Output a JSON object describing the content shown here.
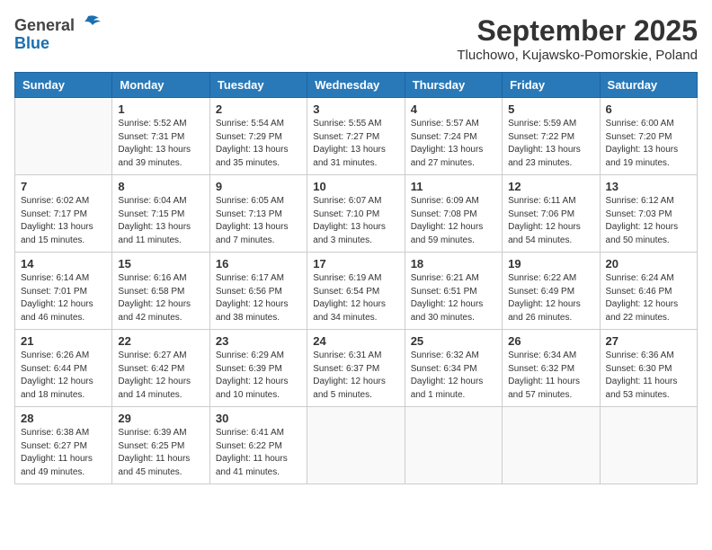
{
  "header": {
    "logo_general": "General",
    "logo_blue": "Blue",
    "month": "September 2025",
    "location": "Tluchowo, Kujawsko-Pomorskie, Poland"
  },
  "weekdays": [
    "Sunday",
    "Monday",
    "Tuesday",
    "Wednesday",
    "Thursday",
    "Friday",
    "Saturday"
  ],
  "weeks": [
    [
      {
        "day": "",
        "info": ""
      },
      {
        "day": "1",
        "info": "Sunrise: 5:52 AM\nSunset: 7:31 PM\nDaylight: 13 hours\nand 39 minutes."
      },
      {
        "day": "2",
        "info": "Sunrise: 5:54 AM\nSunset: 7:29 PM\nDaylight: 13 hours\nand 35 minutes."
      },
      {
        "day": "3",
        "info": "Sunrise: 5:55 AM\nSunset: 7:27 PM\nDaylight: 13 hours\nand 31 minutes."
      },
      {
        "day": "4",
        "info": "Sunrise: 5:57 AM\nSunset: 7:24 PM\nDaylight: 13 hours\nand 27 minutes."
      },
      {
        "day": "5",
        "info": "Sunrise: 5:59 AM\nSunset: 7:22 PM\nDaylight: 13 hours\nand 23 minutes."
      },
      {
        "day": "6",
        "info": "Sunrise: 6:00 AM\nSunset: 7:20 PM\nDaylight: 13 hours\nand 19 minutes."
      }
    ],
    [
      {
        "day": "7",
        "info": "Sunrise: 6:02 AM\nSunset: 7:17 PM\nDaylight: 13 hours\nand 15 minutes."
      },
      {
        "day": "8",
        "info": "Sunrise: 6:04 AM\nSunset: 7:15 PM\nDaylight: 13 hours\nand 11 minutes."
      },
      {
        "day": "9",
        "info": "Sunrise: 6:05 AM\nSunset: 7:13 PM\nDaylight: 13 hours\nand 7 minutes."
      },
      {
        "day": "10",
        "info": "Sunrise: 6:07 AM\nSunset: 7:10 PM\nDaylight: 13 hours\nand 3 minutes."
      },
      {
        "day": "11",
        "info": "Sunrise: 6:09 AM\nSunset: 7:08 PM\nDaylight: 12 hours\nand 59 minutes."
      },
      {
        "day": "12",
        "info": "Sunrise: 6:11 AM\nSunset: 7:06 PM\nDaylight: 12 hours\nand 54 minutes."
      },
      {
        "day": "13",
        "info": "Sunrise: 6:12 AM\nSunset: 7:03 PM\nDaylight: 12 hours\nand 50 minutes."
      }
    ],
    [
      {
        "day": "14",
        "info": "Sunrise: 6:14 AM\nSunset: 7:01 PM\nDaylight: 12 hours\nand 46 minutes."
      },
      {
        "day": "15",
        "info": "Sunrise: 6:16 AM\nSunset: 6:58 PM\nDaylight: 12 hours\nand 42 minutes."
      },
      {
        "day": "16",
        "info": "Sunrise: 6:17 AM\nSunset: 6:56 PM\nDaylight: 12 hours\nand 38 minutes."
      },
      {
        "day": "17",
        "info": "Sunrise: 6:19 AM\nSunset: 6:54 PM\nDaylight: 12 hours\nand 34 minutes."
      },
      {
        "day": "18",
        "info": "Sunrise: 6:21 AM\nSunset: 6:51 PM\nDaylight: 12 hours\nand 30 minutes."
      },
      {
        "day": "19",
        "info": "Sunrise: 6:22 AM\nSunset: 6:49 PM\nDaylight: 12 hours\nand 26 minutes."
      },
      {
        "day": "20",
        "info": "Sunrise: 6:24 AM\nSunset: 6:46 PM\nDaylight: 12 hours\nand 22 minutes."
      }
    ],
    [
      {
        "day": "21",
        "info": "Sunrise: 6:26 AM\nSunset: 6:44 PM\nDaylight: 12 hours\nand 18 minutes."
      },
      {
        "day": "22",
        "info": "Sunrise: 6:27 AM\nSunset: 6:42 PM\nDaylight: 12 hours\nand 14 minutes."
      },
      {
        "day": "23",
        "info": "Sunrise: 6:29 AM\nSunset: 6:39 PM\nDaylight: 12 hours\nand 10 minutes."
      },
      {
        "day": "24",
        "info": "Sunrise: 6:31 AM\nSunset: 6:37 PM\nDaylight: 12 hours\nand 5 minutes."
      },
      {
        "day": "25",
        "info": "Sunrise: 6:32 AM\nSunset: 6:34 PM\nDaylight: 12 hours\nand 1 minute."
      },
      {
        "day": "26",
        "info": "Sunrise: 6:34 AM\nSunset: 6:32 PM\nDaylight: 11 hours\nand 57 minutes."
      },
      {
        "day": "27",
        "info": "Sunrise: 6:36 AM\nSunset: 6:30 PM\nDaylight: 11 hours\nand 53 minutes."
      }
    ],
    [
      {
        "day": "28",
        "info": "Sunrise: 6:38 AM\nSunset: 6:27 PM\nDaylight: 11 hours\nand 49 minutes."
      },
      {
        "day": "29",
        "info": "Sunrise: 6:39 AM\nSunset: 6:25 PM\nDaylight: 11 hours\nand 45 minutes."
      },
      {
        "day": "30",
        "info": "Sunrise: 6:41 AM\nSunset: 6:22 PM\nDaylight: 11 hours\nand 41 minutes."
      },
      {
        "day": "",
        "info": ""
      },
      {
        "day": "",
        "info": ""
      },
      {
        "day": "",
        "info": ""
      },
      {
        "day": "",
        "info": ""
      }
    ]
  ]
}
